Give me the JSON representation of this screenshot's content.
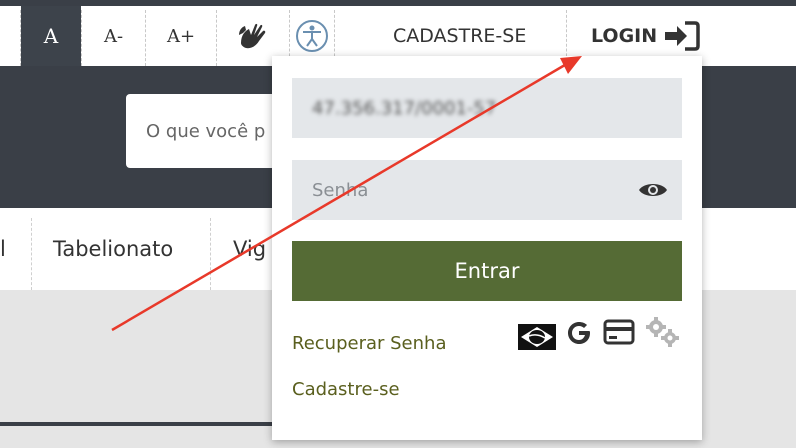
{
  "accessibility": {
    "font_normal": "A",
    "font_decrease": "A-",
    "font_increase": "A+",
    "sign_language_icon": "hand-sign-icon",
    "accessibility_icon": "accessibility-person-icon"
  },
  "nav": {
    "register": "CADASTRE-SE",
    "login": "LOGIN"
  },
  "search": {
    "placeholder": "O que você p"
  },
  "categories": [
    "l",
    "Tabelionato",
    "Vig"
  ],
  "login_form": {
    "username_value": "47.356.317/0001-57",
    "password_placeholder": "Senha",
    "submit": "Entrar",
    "recover_link": "Recuperar Senha",
    "register_link": "Cadastre-se",
    "social_icons": [
      "gov-br-flag-icon",
      "google-icon",
      "card-icon",
      "gears-icon"
    ]
  },
  "colors": {
    "dark": "#3a3f47",
    "olive": "#556b35",
    "link": "#5a5f1e",
    "annotation_arrow": "#e8392a"
  }
}
